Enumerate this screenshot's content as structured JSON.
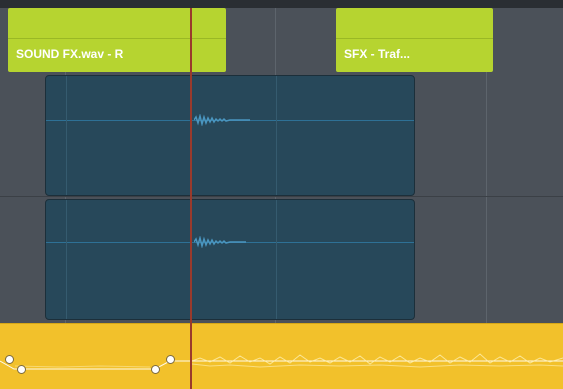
{
  "timeline": {
    "clips": {
      "top_left_label": "SOUND FX.wav - R",
      "top_right_label": "SFX - Traf..."
    }
  },
  "colors": {
    "green_clip": "#b6d430",
    "blue_clip": "#27485a",
    "yellow_clip": "#f2c12b",
    "playhead": "#9a3a2c",
    "background": "#4b5159"
  },
  "icons": {
    "volume_handle": "circle-handle-icon",
    "waveform": "audio-waveform-icon"
  }
}
